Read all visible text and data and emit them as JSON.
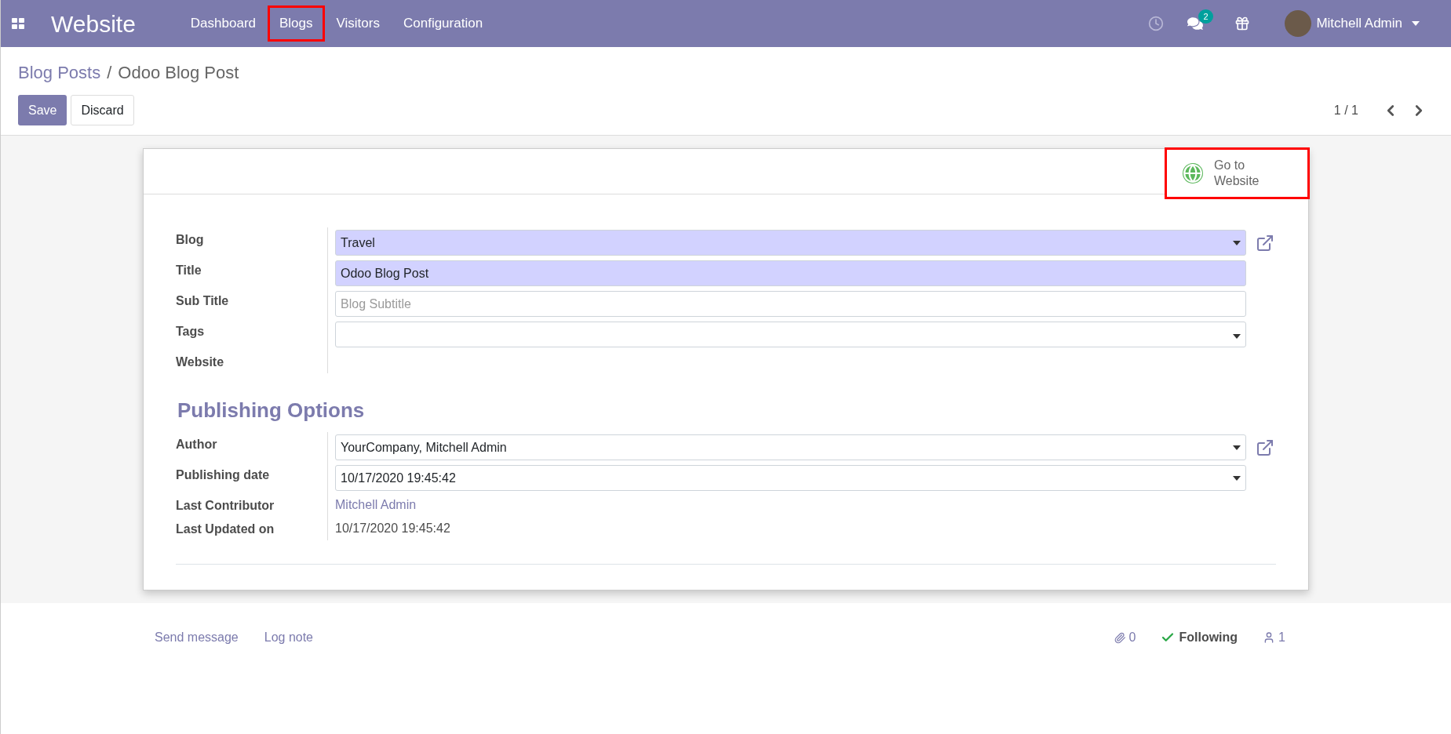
{
  "navbar": {
    "app_title": "Website",
    "menu": [
      {
        "label": "Dashboard",
        "highlighted": false
      },
      {
        "label": "Blogs",
        "highlighted": true
      },
      {
        "label": "Visitors",
        "highlighted": false
      },
      {
        "label": "Configuration",
        "highlighted": false
      }
    ],
    "message_count": "2",
    "user": "Mitchell Admin"
  },
  "breadcrumb": {
    "parent": "Blog Posts",
    "separator": "/",
    "current": "Odoo Blog Post"
  },
  "buttons": {
    "save": "Save",
    "discard": "Discard"
  },
  "pager": "1 / 1",
  "smart_button": {
    "label": "Go to Website",
    "highlighted": true
  },
  "main_fields": [
    {
      "label": "Blog",
      "kind": "select",
      "value": "Travel",
      "focused": true,
      "external_link": true
    },
    {
      "label": "Title",
      "kind": "input",
      "value": "Odoo Blog Post",
      "focused": true,
      "external_link": false
    },
    {
      "label": "Sub Title",
      "kind": "input",
      "placeholder": "Blog Subtitle",
      "focused": false,
      "external_link": false
    },
    {
      "label": "Tags",
      "kind": "tags",
      "focused": false,
      "external_link": false
    },
    {
      "label": "Website",
      "kind": "empty",
      "external_link": false
    }
  ],
  "section_title": "Publishing Options",
  "publishing_fields": [
    {
      "label": "Author",
      "kind": "select",
      "value": "YourCompany, Mitchell Admin",
      "focused": false,
      "external_link": true
    },
    {
      "label": "Publishing date",
      "kind": "select",
      "value": "10/17/2020 19:45:42",
      "focused": false,
      "external_link": false
    },
    {
      "label": "Last Contributor",
      "kind": "link",
      "value": "Mitchell Admin",
      "external_link": false
    },
    {
      "label": "Last Updated on",
      "kind": "text",
      "value": "10/17/2020 19:45:42",
      "external_link": false
    }
  ],
  "chatter": {
    "send_message": "Send message",
    "log_note": "Log note",
    "attachments": "0",
    "follow": "Following",
    "followers": "1"
  }
}
